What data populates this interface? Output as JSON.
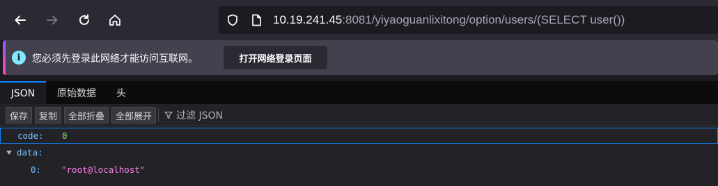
{
  "browser": {
    "url_host": "10.19.241.45",
    "url_rest": ":8081/yiyaoguanlixitong/option/users/(SELECT user())"
  },
  "notification": {
    "message": "您必须先登录此网络才能访问互联网。",
    "button_label": "打开网络登录页面"
  },
  "viewer": {
    "tabs": [
      {
        "label": "JSON",
        "active": true
      },
      {
        "label": "原始数据",
        "active": false
      },
      {
        "label": "头",
        "active": false
      }
    ],
    "toolbar": {
      "save": "保存",
      "copy": "复制",
      "collapse_all": "全部折叠",
      "expand_all": "全部展开",
      "filter_placeholder": "过滤 JSON"
    }
  },
  "json_tree": {
    "rows": [
      {
        "key": "code:",
        "value": "0"
      },
      {
        "key": "data:"
      },
      {
        "key": "0:",
        "value": "\"root@localhost\""
      }
    ]
  },
  "colors": {
    "accent": "#0a84ff",
    "key": "#75bfff",
    "number": "#86de74",
    "string": "#ff7de9"
  }
}
